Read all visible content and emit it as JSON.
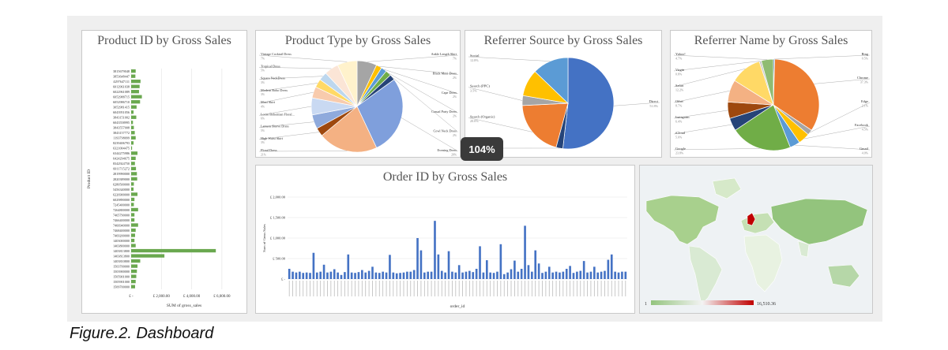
{
  "caption": "Figure.2. Dashboard",
  "zoom_level": "104%",
  "colors": {
    "bar_green": "#6aa84f",
    "blue": "#4472c4",
    "orange": "#ed7d31",
    "gray": "#a5a5a5",
    "yellow": "#ffc000",
    "lightblue": "#5b9bd5",
    "green": "#70ad47"
  },
  "chart_data": [
    {
      "type": "bar",
      "orientation": "horizontal",
      "title": "Product ID by Gross Sales",
      "xlabel": "SUM of gross_sales",
      "ylabel": "Product ID",
      "x_ticks": [
        "£ -",
        "£ 2,000.00",
        "£ 4,000.00",
        "£ 6,000.00"
      ],
      "xlim": [
        0,
        7000
      ],
      "categories": [
        "3815679048",
        "3853648447",
        "4297647111",
        "6012961038",
        "6022961089",
        "6052988715",
        "6052986710",
        "3052981415",
        "6043951056",
        "3843151002",
        "6043558995",
        "3843557008",
        "3843157772",
        "1193798099",
        "8239406793",
        "6321004475",
        "6344275986",
        "6424294675",
        "8342924750",
        "6011715272",
        "2819990000",
        "2820389000",
        "6280500000",
        "5456340000",
        "6226900000",
        "6029890000",
        "7245400000",
        "7264800000",
        "7465790000",
        "7466400000",
        "7466940000",
        "7468400000",
        "7469200000",
        "1403000000",
        "1403800000",
        "1403813800",
        "1403813800",
        "1403810800",
        "1503700000",
        "1503900000",
        "1505901000",
        "1505901000",
        "1509700000"
      ],
      "values": [
        300,
        280,
        620,
        560,
        520,
        710,
        590,
        360,
        160,
        340,
        120,
        180,
        240,
        300,
        160,
        60,
        420,
        300,
        250,
        320,
        380,
        400,
        180,
        160,
        420,
        220,
        180,
        460,
        220,
        220,
        460,
        300,
        260,
        220,
        300,
        5600,
        2200,
        600,
        420,
        380,
        340,
        300,
        260
      ]
    },
    {
      "type": "pie",
      "title": "Product Type by Gross Sales",
      "slices": [
        {
          "label": "Ankle Length Skirt",
          "pct": "7%",
          "value": 7,
          "color": "#a5a5a5"
        },
        {
          "label": "Black Maxi Dress",
          "pct": "2%",
          "value": 2,
          "color": "#ffc000"
        },
        {
          "label": "Cape Dress",
          "pct": "2%",
          "value": 2,
          "color": "#5b9bd5"
        },
        {
          "label": "Casual Party Dress",
          "pct": "2%",
          "value": 2,
          "color": "#70ad47"
        },
        {
          "label": "Cowl Neck Dress",
          "pct": "2%",
          "value": 2,
          "color": "#264478"
        },
        {
          "label": "Evening Dress",
          "pct": "28%",
          "value": 28,
          "color": "#7f9fdc"
        },
        {
          "label": "Floral Dress",
          "pct": "21%",
          "value": 21,
          "color": "#f4b183"
        },
        {
          "label": "High Waist Skirt",
          "pct": "3%",
          "value": 3,
          "color": "#9e480e"
        },
        {
          "label": "Lantern Sleeve Dress",
          "pct": "5%",
          "value": 5,
          "color": "#8faadc"
        },
        {
          "label": "Loose Bohemian Floral...",
          "pct": "6%",
          "value": 6,
          "color": "#c9d9f2"
        },
        {
          "label": "Maxi Skirt",
          "pct": "4%",
          "value": 4,
          "color": "#f8cbad"
        },
        {
          "label": "Modern Boho Dress",
          "pct": "3%",
          "value": 3,
          "color": "#ffd966"
        },
        {
          "label": "Square NeckDress",
          "pct": "3%",
          "value": 3,
          "color": "#bdd7ee"
        },
        {
          "label": "Tropical Dress",
          "pct": "5%",
          "value": 5,
          "color": "#fbe5d6"
        },
        {
          "label": "Vintage Cocktail Dress",
          "pct": "7%",
          "value": 7,
          "color": "#fff2cc"
        }
      ]
    },
    {
      "type": "pie",
      "title": "Referrer Source by Gross Sales",
      "slices": [
        {
          "label": "Direct",
          "pct": "51.8%",
          "value": 51.8,
          "color": "#4472c4"
        },
        {
          "label": "Email",
          "pct": "2.4%",
          "value": 2.4,
          "color": "#264478"
        },
        {
          "label": "Search (Organic)",
          "pct": "20.0%",
          "value": 20.0,
          "color": "#ed7d31"
        },
        {
          "label": "Search (PPC)",
          "pct": "3.5%",
          "value": 3.5,
          "color": "#a5a5a5"
        },
        {
          "label": "",
          "pct": "",
          "value": 9.5,
          "color": "#ffc000"
        },
        {
          "label": "Social",
          "pct": "12.8%",
          "value": 12.8,
          "color": "#5b9bd5"
        }
      ]
    },
    {
      "type": "pie",
      "title": "Referrer Name by Gross Sales",
      "slices": [
        {
          "label": "Bing",
          "pct": "0.5%",
          "value": 0.5,
          "color": "#4472c4"
        },
        {
          "label": "Chrome",
          "pct": "37.3%",
          "value": 37.3,
          "color": "#ed7d31"
        },
        {
          "label": "Edge",
          "pct": "2.1%",
          "value": 2.1,
          "color": "#a5a5a5"
        },
        {
          "label": "Facebook",
          "pct": "4.5%",
          "value": 4.5,
          "color": "#ffc000"
        },
        {
          "label": "Gmail",
          "pct": "4.0%",
          "value": 4.0,
          "color": "#5b9bd5"
        },
        {
          "label": "Google",
          "pct": "23.8%",
          "value": 23.8,
          "color": "#70ad47"
        },
        {
          "label": "iCloud",
          "pct": "5.0%",
          "value": 5.0,
          "color": "#264478"
        },
        {
          "label": "Instagram",
          "pct": "6.4%",
          "value": 6.4,
          "color": "#9e480e"
        },
        {
          "label": "Other",
          "pct": "8.7%",
          "value": 8.7,
          "color": "#f4b183"
        },
        {
          "label": "Safari",
          "pct": "12.2%",
          "value": 12.2,
          "color": "#ffd966"
        },
        {
          "label": "Virgin",
          "pct": "0.8%",
          "value": 0.8,
          "color": "#c9c9c9"
        },
        {
          "label": "Yahoo!",
          "pct": "4.7%",
          "value": 4.7,
          "color": "#8fbc72"
        }
      ]
    },
    {
      "type": "bar",
      "title": "Order ID by Gross Sales",
      "xlabel": "order_id",
      "ylabel": "Sum of Gross Sales",
      "y_ticks": [
        "£ 2,000.00",
        "£ 1,500.00",
        "£ 1,000.00",
        "£ 500.00",
        "£ -"
      ],
      "ylim": [
        0,
        2000
      ],
      "values": [
        250,
        180,
        160,
        180,
        150,
        160,
        150,
        640,
        160,
        180,
        350,
        160,
        180,
        240,
        160,
        100,
        170,
        600,
        160,
        150,
        170,
        220,
        160,
        200,
        300,
        160,
        150,
        180,
        160,
        590,
        160,
        140,
        150,
        160,
        180,
        180,
        220,
        1000,
        700,
        160,
        180,
        180,
        1420,
        600,
        200,
        160,
        680,
        180,
        160,
        340,
        160,
        180,
        200,
        170,
        250,
        800,
        160,
        460,
        160,
        150,
        180,
        850,
        120,
        160,
        240,
        450,
        180,
        250,
        1300,
        340,
        180,
        700,
        380,
        150,
        180,
        300,
        160,
        180,
        160,
        180,
        250,
        320,
        150,
        180,
        200,
        440,
        160,
        180,
        300,
        160,
        180,
        200,
        470,
        600,
        180,
        160,
        180,
        180
      ]
    },
    {
      "type": "map",
      "legend_min": "1",
      "legend_max": "16,510.36"
    }
  ]
}
